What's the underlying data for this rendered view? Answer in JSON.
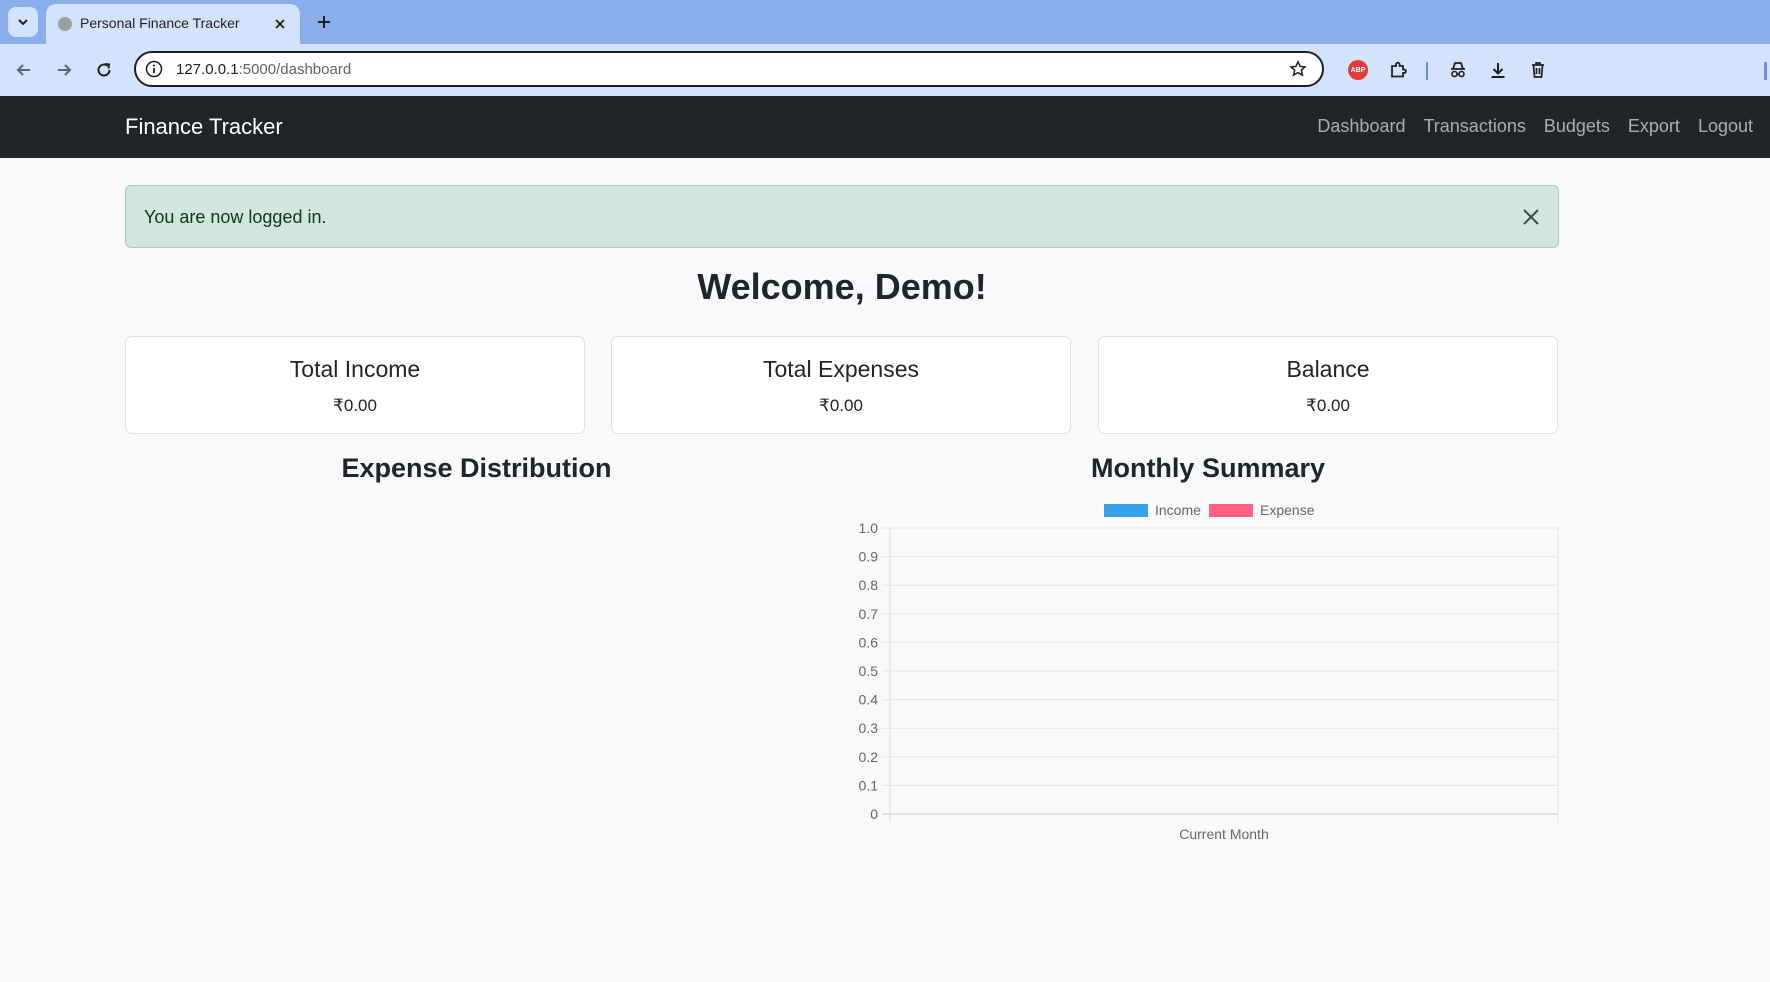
{
  "browser": {
    "tab_title": "Personal Finance Tracker",
    "url_host": "127.0.0.1",
    "url_path": ":5000/dashboard"
  },
  "navbar": {
    "brand": "Finance Tracker",
    "links": [
      "Dashboard",
      "Transactions",
      "Budgets",
      "Export",
      "Logout"
    ]
  },
  "alert": {
    "message": "You are now logged in."
  },
  "welcome": "Welcome, Demo!",
  "cards": [
    {
      "title": "Total Income",
      "value": "₹0.00"
    },
    {
      "title": "Total Expenses",
      "value": "₹0.00"
    },
    {
      "title": "Balance",
      "value": "₹0.00"
    }
  ],
  "sections": {
    "expense_distribution": "Expense Distribution",
    "monthly_summary": "Monthly Summary"
  },
  "chart_data": {
    "type": "bar",
    "title": "",
    "categories": [
      "Current Month"
    ],
    "series": [
      {
        "name": "Income",
        "values": [
          0
        ],
        "color": "#36a2eb"
      },
      {
        "name": "Expense",
        "values": [
          0
        ],
        "color": "#ff6384"
      }
    ],
    "ylim": [
      0,
      1
    ],
    "yticks": [
      "1.0",
      "0.9",
      "0.8",
      "0.7",
      "0.6",
      "0.5",
      "0.4",
      "0.3",
      "0.2",
      "0.1",
      "0"
    ],
    "grid": true,
    "legend": "top"
  },
  "colors": {
    "navbar_bg": "#212529",
    "alert_bg": "#d1e7dd",
    "income": "#36a2eb",
    "expense": "#ff6384"
  }
}
